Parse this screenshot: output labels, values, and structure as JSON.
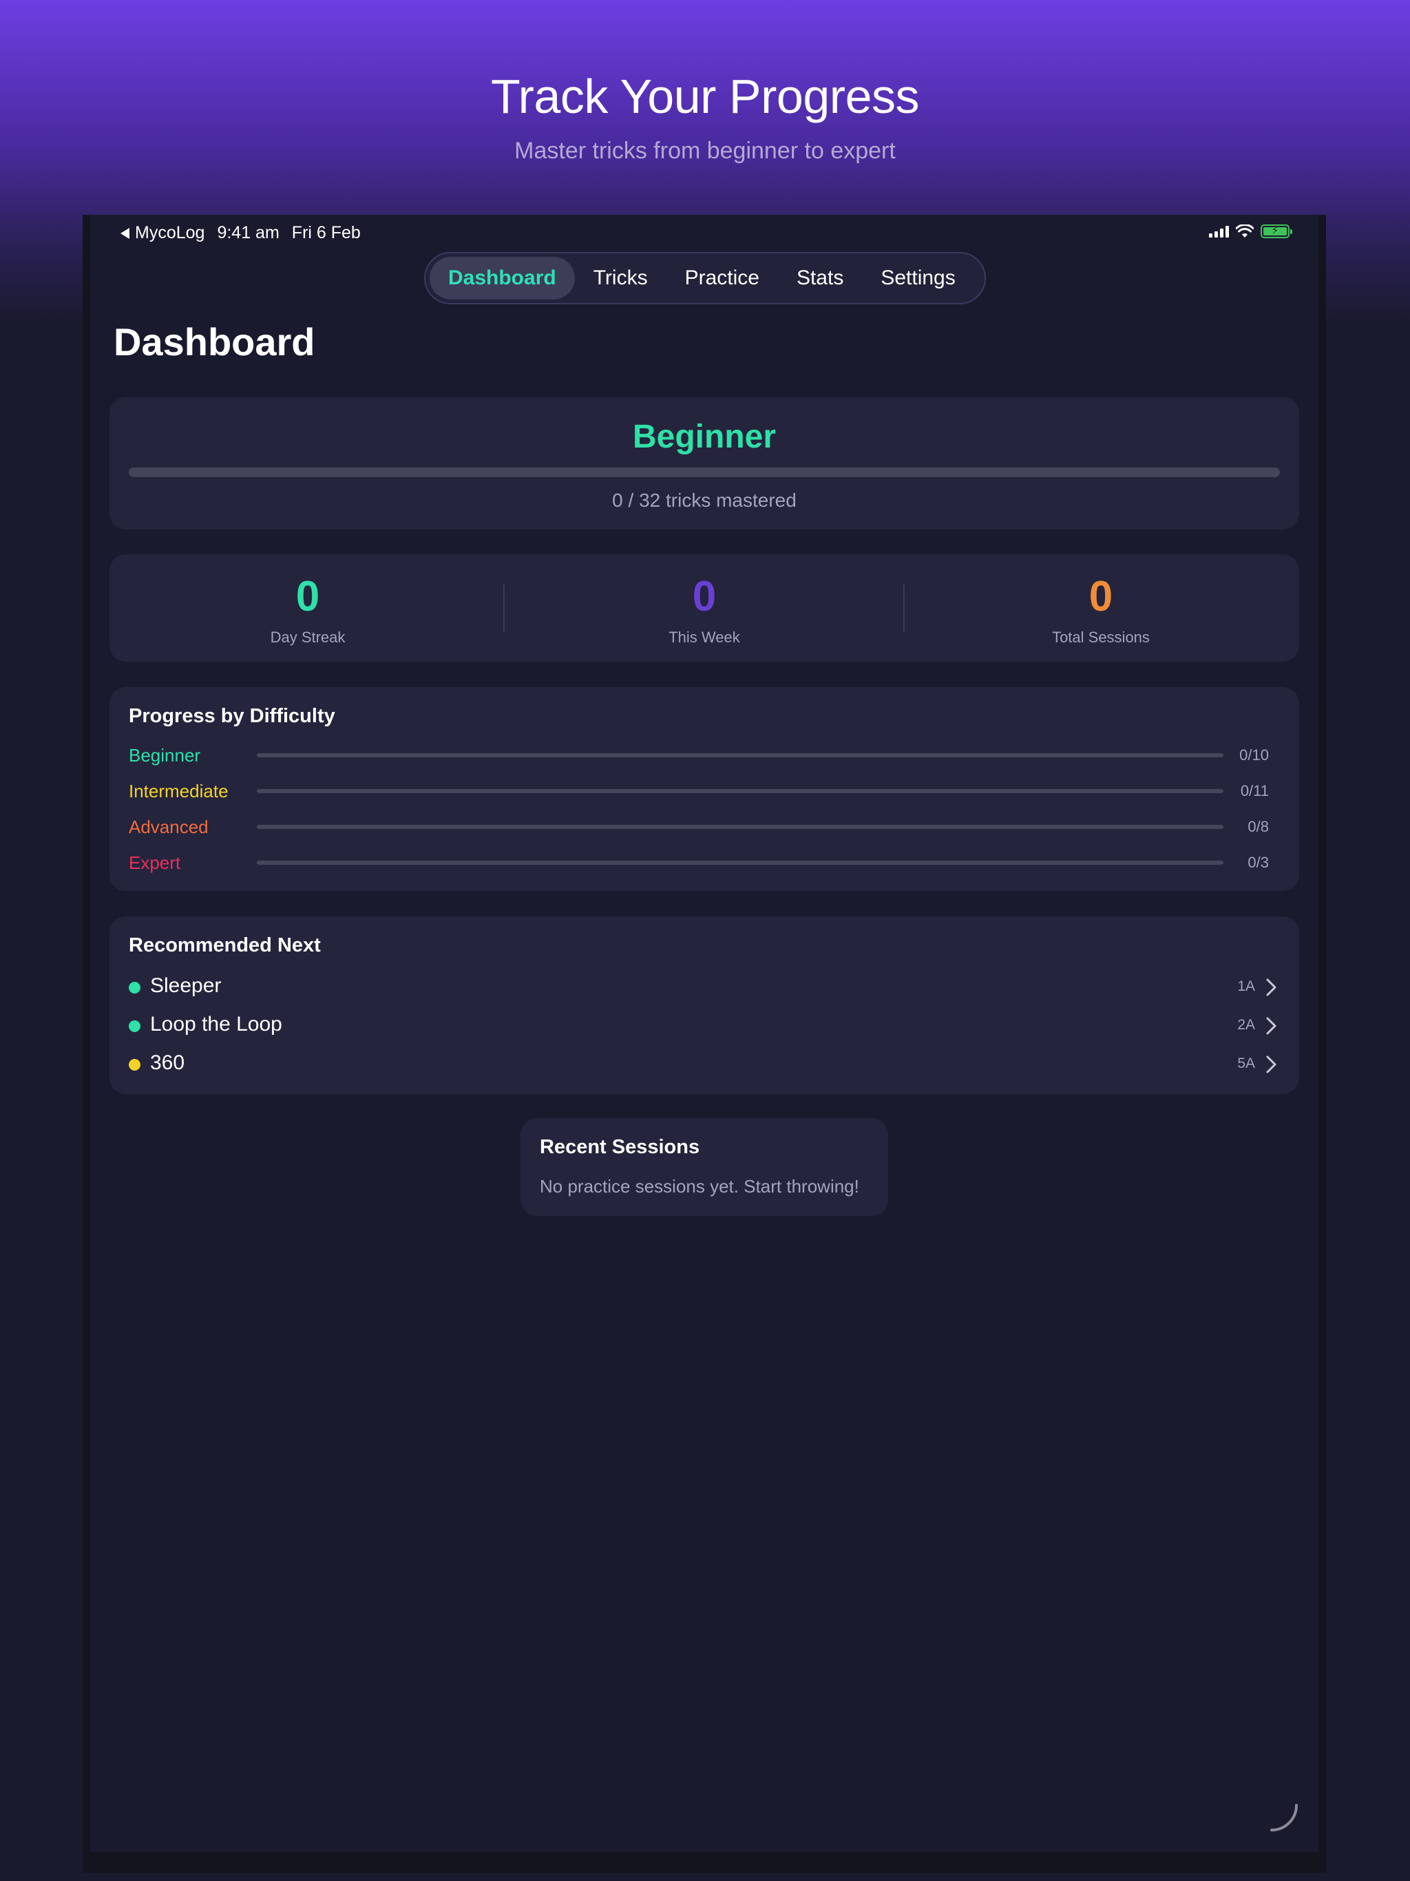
{
  "hero": {
    "title": "Track Your Progress",
    "subtitle": "Master tricks from beginner to expert"
  },
  "status_bar": {
    "back_app": "MycoLog",
    "time": "9:41 am",
    "date": "Fri 6 Feb",
    "icons": [
      "cellular-signal-icon",
      "wifi-icon",
      "battery-charging-icon"
    ]
  },
  "tabs": [
    {
      "label": "Dashboard",
      "active": true
    },
    {
      "label": "Tricks",
      "active": false
    },
    {
      "label": "Practice",
      "active": false
    },
    {
      "label": "Stats",
      "active": false
    },
    {
      "label": "Settings",
      "active": false
    }
  ],
  "page_title": "Dashboard",
  "level": {
    "name": "Beginner",
    "progress": 0,
    "caption": "0 / 32 tricks mastered",
    "color": "#2fe0a7"
  },
  "stats": [
    {
      "value": "0",
      "label": "Day Streak",
      "color": "#2fe0a7"
    },
    {
      "value": "0",
      "label": "This Week",
      "color": "#6a3fd6"
    },
    {
      "value": "0",
      "label": "Total Sessions",
      "color": "#f28c38"
    }
  ],
  "difficulty": {
    "title": "Progress by Difficulty",
    "rows": [
      {
        "name": "Beginner",
        "count": "0/10",
        "progress": 0,
        "color": "#2fe0a7"
      },
      {
        "name": "Intermediate",
        "count": "0/11",
        "progress": 0,
        "color": "#f5d327"
      },
      {
        "name": "Advanced",
        "count": "0/8",
        "progress": 0,
        "color": "#f26c3a"
      },
      {
        "name": "Expert",
        "count": "0/3",
        "progress": 0,
        "color": "#e8305a"
      }
    ]
  },
  "recommended": {
    "title": "Recommended Next",
    "items": [
      {
        "name": "Sleeper",
        "code": "1A",
        "color": "#2fe0a7"
      },
      {
        "name": "Loop the Loop",
        "code": "2A",
        "color": "#2fe0a7"
      },
      {
        "name": "360",
        "code": "5A",
        "color": "#f5d327"
      }
    ]
  },
  "recent": {
    "title": "Recent Sessions",
    "empty_text": "No practice sessions yet. Start throwing!"
  }
}
